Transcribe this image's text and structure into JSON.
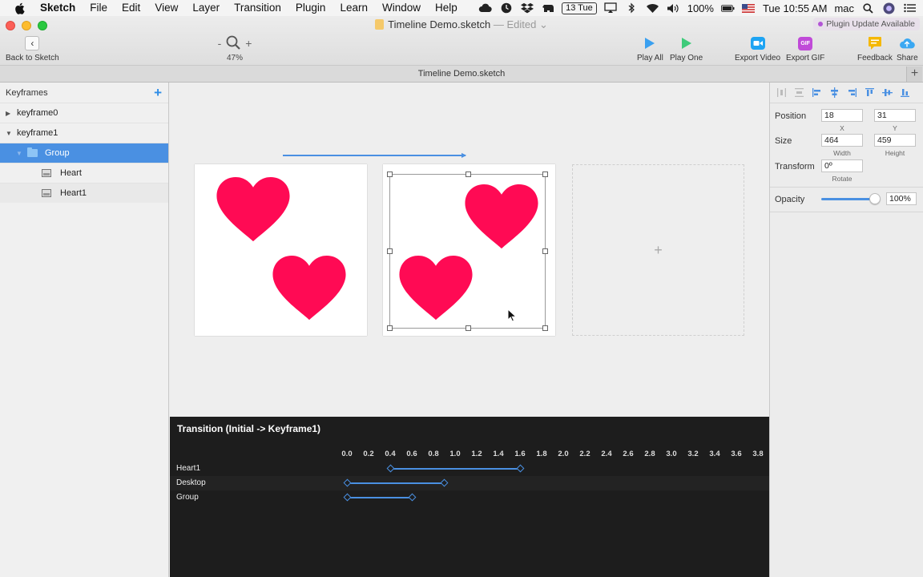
{
  "menubar": {
    "app": "Sketch",
    "items": [
      "File",
      "Edit",
      "View",
      "Layer",
      "Transition",
      "Plugin",
      "Learn",
      "Window",
      "Help"
    ],
    "date_badge": "13 Tue",
    "battery": "100%",
    "clock": "Tue 10:55 AM",
    "user": "mac"
  },
  "window": {
    "title": "Timeline Demo.sketch",
    "edited": "— Edited",
    "plugin_badge": "Plugin Update Available"
  },
  "toolbar": {
    "back_label": "Back to Sketch",
    "zoom_minus": "-",
    "zoom_plus": "+",
    "zoom_value": "47%",
    "play_all": "Play All",
    "play_one": "Play One",
    "export_video": "Export Video",
    "export_gif": "Export GIF",
    "gif_text": "GIF",
    "feedback": "Feedback",
    "share": "Share"
  },
  "tabbar": {
    "title": "Timeline Demo.sketch",
    "plus": "+"
  },
  "sidebar": {
    "header": "Keyframes",
    "add": "+",
    "layers": [
      {
        "label": "keyframe0",
        "expanded": false
      },
      {
        "label": "keyframe1",
        "expanded": true
      },
      {
        "label": "Group",
        "selected": true
      },
      {
        "label": "Heart"
      },
      {
        "label": "Heart1"
      }
    ]
  },
  "canvas": {
    "heart_color": "#ff0a54",
    "selection_color": "#9a9a9a",
    "flow_color": "#4a90e2",
    "add_artboard": "+"
  },
  "inspector": {
    "position_label": "Position",
    "x": "18",
    "x_cap": "X",
    "y": "31",
    "y_cap": "Y",
    "size_label": "Size",
    "width": "464",
    "width_cap": "Width",
    "height": "459",
    "height_cap": "Height",
    "transform_label": "Transform",
    "rotate": "0º",
    "rotate_cap": "Rotate",
    "opacity_label": "Opacity",
    "opacity": "100%"
  },
  "timeline": {
    "title": "Transition (Initial -> Keyframe1)",
    "ticks": [
      "0.0",
      "0.2",
      "0.4",
      "0.6",
      "0.8",
      "1.0",
      "1.2",
      "1.4",
      "1.6",
      "1.8",
      "2.0",
      "2.2",
      "2.4",
      "2.6",
      "2.8",
      "3.0",
      "3.2",
      "3.4",
      "3.6",
      "3.8"
    ],
    "tracks": [
      {
        "label": "Heart1",
        "start": 0.4,
        "end": 1.6
      },
      {
        "label": "Desktop",
        "start": 0.0,
        "end": 0.9
      },
      {
        "label": "Group",
        "start": 0.0,
        "end": 0.6
      }
    ]
  }
}
